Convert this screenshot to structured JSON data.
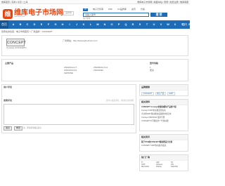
{
  "topbar": {
    "left": "维库首页 | 深圳 | 北京 | 上海",
    "right": "维库电子市场网 | 收藏本站 | 登录 | 免费注册 | 维库客服"
  },
  "header": {
    "logo_mark": "维",
    "logo_name": "维库电子市场网",
    "logo_url": "www.dzsc.com",
    "badge": "品牌库"
  },
  "search": {
    "tabs": [
      "IC",
      "电子元件库",
      "PDF",
      "IC/品牌库",
      "资讯",
      "方案"
    ],
    "active_tab": 0,
    "placeholder": "请输入关键字",
    "value": "请输入型号",
    "button": "搜 索",
    "hot": "热门搜索："
  },
  "nav": {
    "home": "首页",
    "letters": [
      "A",
      "B",
      "C",
      "D",
      "E",
      "F",
      "G",
      "H",
      "I",
      "J",
      "K",
      "L",
      "M",
      "N",
      "O",
      "P",
      "Q",
      "R",
      "S",
      "T",
      "U",
      "V",
      "W",
      "X",
      "Y",
      "Z",
      "0-9"
    ],
    "extra": "国内"
  },
  "breadcrumb": "您所在的位置：电子市场首页 > 厂商品牌 > CONCEPT",
  "product": {
    "logo_text": "CONCEPT",
    "model": "Concept (CONCEPT)",
    "info": "厂商网站：http://www.igbt-driver.com"
  },
  "specs": {
    "label_left": "主营产品",
    "label_right": "型号导航",
    "values_a": [
      "2SD106AI-17",
      "2SD315AI-33",
      "IGD515EI"
    ],
    "values_b": [
      "2SD300C17A1",
      "2SD316EI"
    ],
    "values_c": [
      "1",
      "更多"
    ]
  },
  "comment": {
    "title": "用户评论",
    "sub": "发表评论",
    "hint": "您可以发表评论，请注意言辞文明",
    "buttons": [
      "发表",
      "重置"
    ],
    "note": "注：评论需审核后显示"
  },
  "side": {
    "h1": "品牌搜索",
    "tags": [
      "CONCEPT",
      "电子产品",
      "IGBT"
    ],
    "h2": "相关资料",
    "items2": [
      "CONCEPT Concept的驱动模块产品线介绍",
      "Concept IGBT驱动器选型指南",
      "大功率IGBT驱动器在变频器中的应用",
      "Concept 2SD315AI 使用手册",
      "CONCEPT公司推出新一代驱动器"
    ],
    "h3": "相关资讯",
    "items3": [
      "基于PCB的CONCEPT驱动器设计方案",
      "CONCEPT IGBT驱动技术发展"
    ],
    "h4": "热门厂商",
    "grid": [
      "TI",
      "ADI",
      "ST",
      "NXP",
      "Infineon",
      "ON",
      "Microchip",
      "Vishay",
      "Fairchild"
    ]
  }
}
